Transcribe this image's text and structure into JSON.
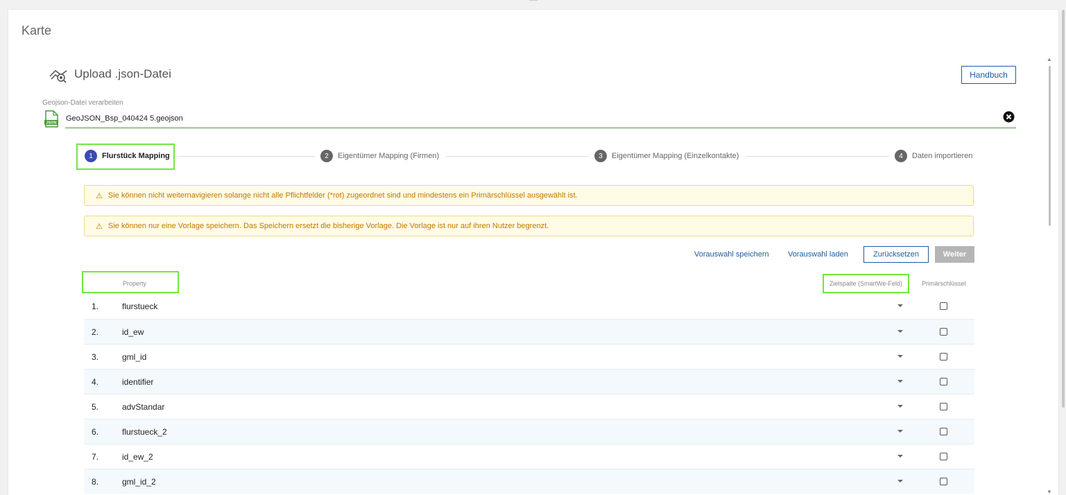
{
  "card": {
    "title": "Karte"
  },
  "upload": {
    "title": "Upload .json-Datei",
    "handbook_label": "Handbuch"
  },
  "file": {
    "label": "Geojson-Datei verarbeiten",
    "value": "GeoJSON_Bsp_040424 5.geojson",
    "icon_text": "JSON"
  },
  "stepper": {
    "steps": [
      {
        "num": "1",
        "label": "Flurstück Mapping",
        "active": true
      },
      {
        "num": "2",
        "label": "Eigentümer Mapping (Firmen)",
        "active": false
      },
      {
        "num": "3",
        "label": "Eigentümer Mapping (Einzelkontakte)",
        "active": false
      },
      {
        "num": "4",
        "label": "Daten importieren",
        "active": false
      }
    ]
  },
  "alerts": [
    "Sie können nicht weiternavigieren solange nicht alle Pflichtfelder (*rot) zugeordnet sind und mindestens ein Primärschlüssel ausgewählt ist.",
    "Sie können nur eine Vorlage speichern. Das Speichern ersetzt die bisherige Vorlage. Die Vorlage ist nur auf ihren Nutzer begrenzt."
  ],
  "actions": {
    "save_selection": "Vorauswahl speichern",
    "load_selection": "Vorauswahl laden",
    "reset": "Zurücksetzen",
    "next": "Weiter"
  },
  "table": {
    "headers": {
      "property": "Property",
      "target": "Zielspalte (SmartWe-Feld)",
      "primary_key": "Primärschlüssel"
    },
    "rows": [
      {
        "num": "1.",
        "name": "flurstueck"
      },
      {
        "num": "2.",
        "name": "id_ew"
      },
      {
        "num": "3.",
        "name": "gml_id"
      },
      {
        "num": "4.",
        "name": "identifier"
      },
      {
        "num": "5.",
        "name": "advStandar"
      },
      {
        "num": "6.",
        "name": "flurstueck_2"
      },
      {
        "num": "7.",
        "name": "id_ew_2"
      },
      {
        "num": "8.",
        "name": "gml_id_2"
      }
    ]
  },
  "icons": {
    "upload": "map-upload-icon",
    "file": "json-file-icon",
    "clear": "close-circle-icon",
    "warning": "warning-icon",
    "dropdown": "caret-down-icon"
  },
  "colors": {
    "primary": "#1f5a99",
    "step_active": "#3a4cb0",
    "highlight": "#6ee93c",
    "warning_text": "#c07a00",
    "warning_bg": "#fffbe5",
    "file_underline": "#4a9a3a"
  }
}
